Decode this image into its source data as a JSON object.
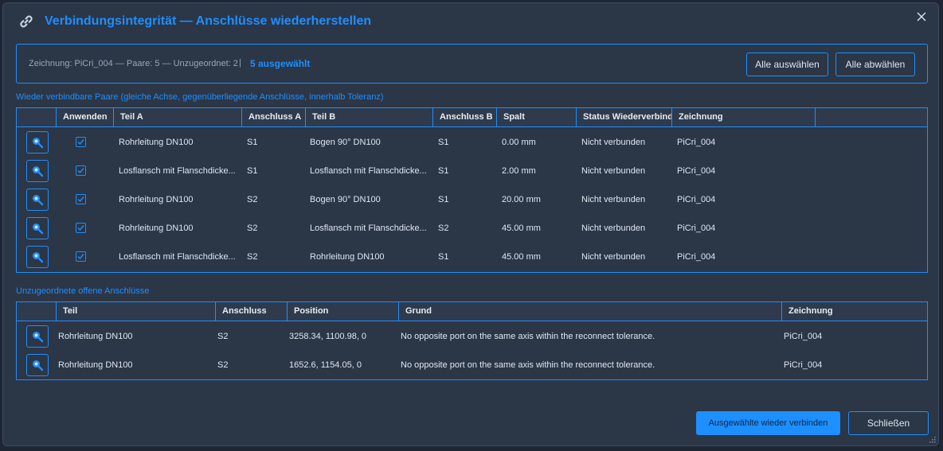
{
  "dialog": {
    "title": "Verbindungsintegrität — Anschlüsse wiederherstellen",
    "title_icon": "link-icon",
    "close_icon": "close-icon"
  },
  "summary": {
    "info": "Zeichnung: PiCri_004 — Paare: 5 — Unzugeordnet: 2",
    "separator": "|",
    "selected": "5 ausgewählt",
    "select_all": "Alle auswählen",
    "deselect_all": "Alle abwählen"
  },
  "pairs": {
    "label": "Wieder verbindbare Paare (gleiche Achse, gegenüberliegende Anschlüsse, innerhalb Toleranz)",
    "headers": [
      "",
      "Anwenden",
      "Teil A",
      "Anschluss A",
      "Teil B",
      "Anschluss B",
      "Spalt",
      "Status Wiederverbindung",
      "Zeichnung"
    ],
    "rows": [
      {
        "apply": true,
        "part_a": "Rohrleitung DN100",
        "port_a": "S1",
        "part_b": "Bogen 90° DN100",
        "port_b": "S1",
        "gap": "0.00 mm",
        "status": "Nicht verbunden",
        "drawing": "PiCri_004"
      },
      {
        "apply": true,
        "part_a": "Losflansch mit Flanschdicke...",
        "port_a": "S1",
        "part_b": "Losflansch mit Flanschdicke...",
        "port_b": "S1",
        "gap": "2.00 mm",
        "status": "Nicht verbunden",
        "drawing": "PiCri_004"
      },
      {
        "apply": true,
        "part_a": "Rohrleitung DN100",
        "port_a": "S2",
        "part_b": "Bogen 90° DN100",
        "port_b": "S1",
        "gap": "20.00 mm",
        "status": "Nicht verbunden",
        "drawing": "PiCri_004"
      },
      {
        "apply": true,
        "part_a": "Rohrleitung DN100",
        "port_a": "S2",
        "part_b": "Losflansch mit Flanschdicke...",
        "port_b": "S2",
        "gap": "45.00 mm",
        "status": "Nicht verbunden",
        "drawing": "PiCri_004"
      },
      {
        "apply": true,
        "part_a": "Losflansch mit Flanschdicke...",
        "port_a": "S2",
        "part_b": "Rohrleitung DN100",
        "port_b": "S1",
        "gap": "45.00 mm",
        "status": "Nicht verbunden",
        "drawing": "PiCri_004"
      }
    ]
  },
  "orphans": {
    "label": "Unzugeordnete offene Anschlüsse",
    "headers": [
      "",
      "Teil",
      "Anschluss",
      "Position",
      "Grund",
      "Zeichnung"
    ],
    "rows": [
      {
        "part": "Rohrleitung DN100",
        "port": "S2",
        "position": "3258.34, 1100.98, 0",
        "reason": "No opposite port on the same axis within the reconnect tolerance.",
        "drawing": "PiCri_004"
      },
      {
        "part": "Rohrleitung DN100",
        "port": "S2",
        "position": "1652.6, 1154.05, 0",
        "reason": "No opposite port on the same axis within the reconnect tolerance.",
        "drawing": "PiCri_004"
      }
    ]
  },
  "footer": {
    "reconnect": "Ausgewählte wieder verbinden",
    "close": "Schließen"
  },
  "colors": {
    "accent": "#1e8fff",
    "panel": "#2b3647",
    "background": "#1e2633"
  }
}
